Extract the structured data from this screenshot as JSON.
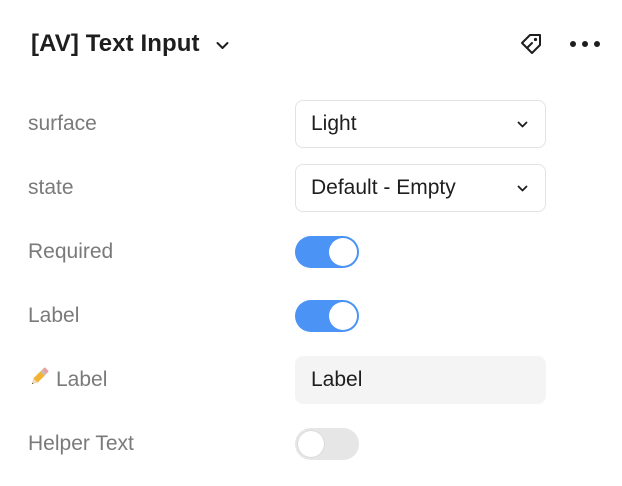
{
  "header": {
    "title": "[AV] Text Input",
    "icons": {
      "title_dropdown": "chevron-down-icon",
      "component": "component-tag-icon",
      "more": "more-horizontal-icon"
    }
  },
  "properties": {
    "surface": {
      "label": "surface",
      "value": "Light",
      "type": "select"
    },
    "state": {
      "label": "state",
      "value": "Default - Empty",
      "type": "select"
    },
    "required": {
      "label": "Required",
      "checked": true,
      "type": "toggle"
    },
    "label_toggle": {
      "label": "Label",
      "checked": true,
      "type": "toggle"
    },
    "label_text": {
      "label": "Label",
      "value": "Label",
      "type": "text",
      "icon": "pencil-icon"
    },
    "helper_text": {
      "label": "Helper Text",
      "checked": false,
      "type": "toggle"
    }
  },
  "colors": {
    "toggle_on": "#4b93f4",
    "toggle_off": "#e6e6e6",
    "label_text": "#7a7a7a",
    "value_text": "#1e1e1e",
    "input_bg": "#f4f4f4",
    "select_border": "#e3e3e3"
  }
}
